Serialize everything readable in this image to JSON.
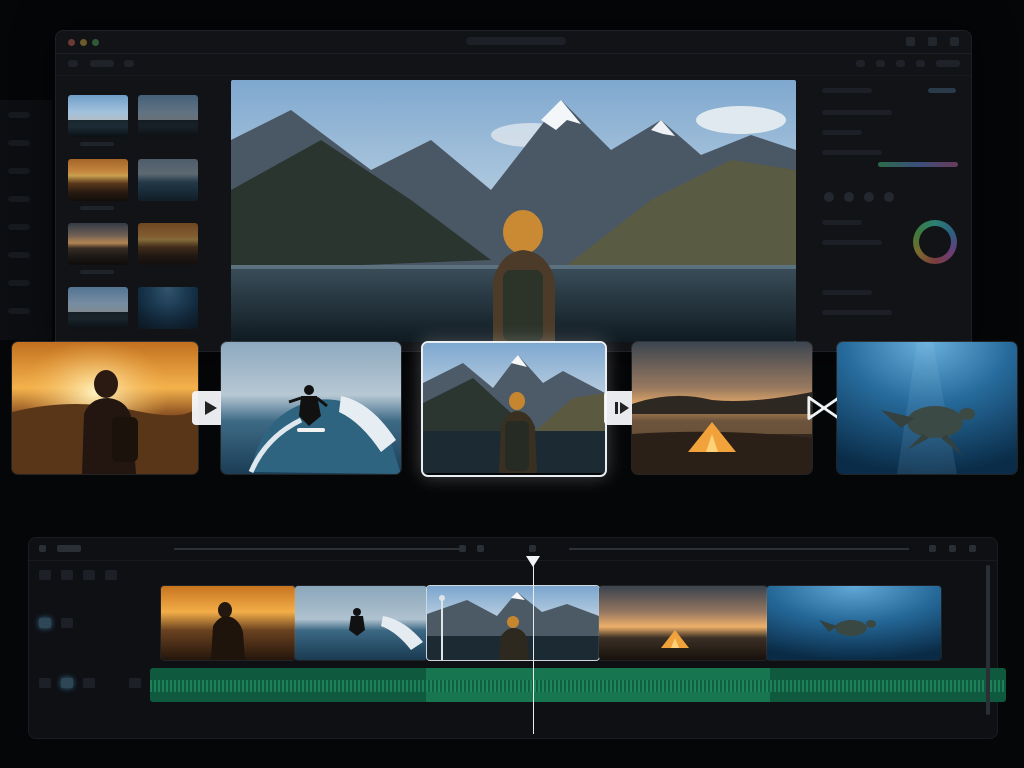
{
  "app": {
    "window_title": "",
    "accent_color": "#e9eef3",
    "audio_color": "#0f5a3f"
  },
  "clips": [
    {
      "name": "sunset-hiker",
      "scene": "sunset"
    },
    {
      "name": "surfer-wave",
      "scene": "surf"
    },
    {
      "name": "mountain-lake-hiker",
      "scene": "day",
      "selected": true
    },
    {
      "name": "tent-sunset",
      "scene": "camp"
    },
    {
      "name": "sea-turtle",
      "scene": "ocean"
    }
  ],
  "transitions": [
    {
      "icon": "play-icon"
    },
    {
      "icon": "skip-forward-icon"
    },
    {
      "icon": "bowtie-transition-icon"
    }
  ],
  "timeline": {
    "audio_track_label": "",
    "clip_count": 5
  }
}
